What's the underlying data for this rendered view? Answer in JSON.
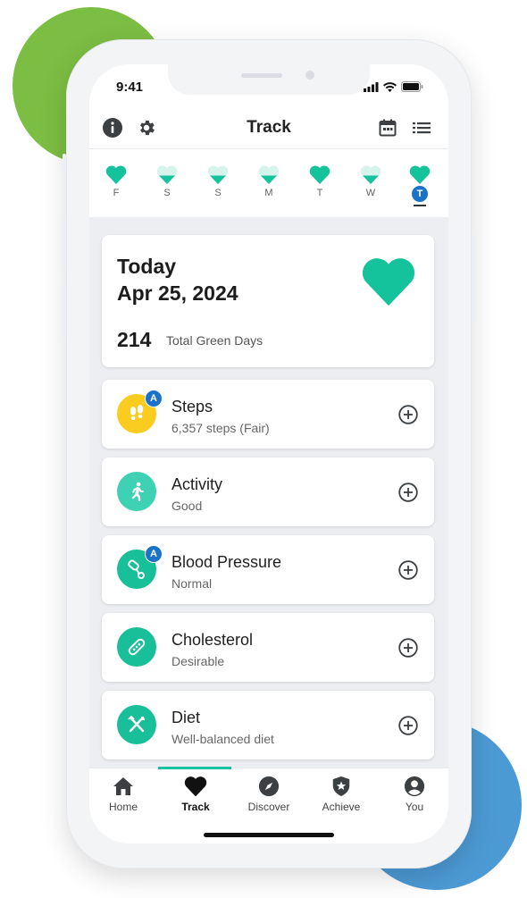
{
  "status_bar": {
    "time": "9:41"
  },
  "header": {
    "title": "Track"
  },
  "days": [
    {
      "label": "F",
      "state": "full"
    },
    {
      "label": "S",
      "state": "partial"
    },
    {
      "label": "S",
      "state": "partial"
    },
    {
      "label": "M",
      "state": "partial"
    },
    {
      "label": "T",
      "state": "full"
    },
    {
      "label": "W",
      "state": "partial"
    },
    {
      "label": "T",
      "state": "full",
      "selected": true
    }
  ],
  "summary": {
    "title_line1": "Today",
    "title_line2": "Apr 25, 2024",
    "green_days_count": "214",
    "green_days_label": "Total Green Days"
  },
  "items": [
    {
      "name": "Steps",
      "value": "6,357 steps (Fair)",
      "badge": "A",
      "icon": "footprints-icon",
      "color": "#f9cc1f"
    },
    {
      "name": "Activity",
      "value": "Good",
      "badge": "",
      "icon": "running-person-icon",
      "color": "#3ed1b4"
    },
    {
      "name": "Blood Pressure",
      "value": "Normal",
      "badge": "A",
      "icon": "blood-pressure-cuff-icon",
      "color": "#19bf98"
    },
    {
      "name": "Cholesterol",
      "value": "Desirable",
      "badge": "",
      "icon": "artery-icon",
      "color": "#19bf98"
    },
    {
      "name": "Diet",
      "value": "Well-balanced diet",
      "badge": "",
      "icon": "fork-knife-icon",
      "color": "#19bf98"
    }
  ],
  "tabs": [
    {
      "label": "Home",
      "icon": "home-icon"
    },
    {
      "label": "Track",
      "icon": "heart-icon",
      "active": true
    },
    {
      "label": "Discover",
      "icon": "compass-icon"
    },
    {
      "label": "Achieve",
      "icon": "star-shield-icon"
    },
    {
      "label": "You",
      "icon": "user-circle-icon"
    }
  ],
  "colors": {
    "accent": "#19c3a1",
    "heart": "#14c29b",
    "heart_partial": "#d6f3ec",
    "badge": "#1a73c8",
    "green_blob": "#7cbd43",
    "blue_blob": "#4c9ad4"
  }
}
